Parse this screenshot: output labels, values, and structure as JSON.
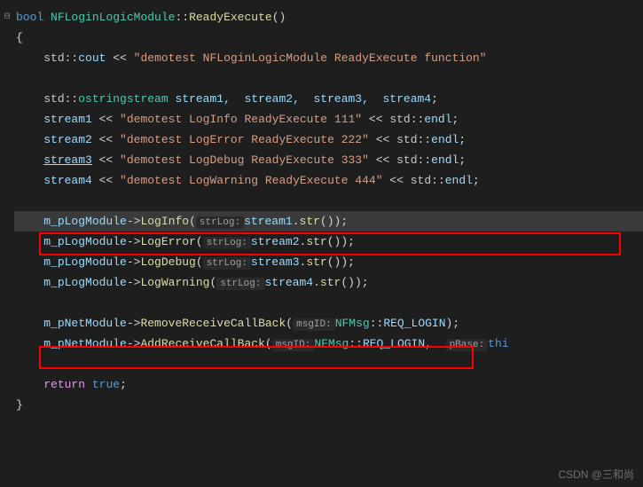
{
  "signature": {
    "ret_type": "bool",
    "class_name": "NFLoginLogicModule",
    "scope": "::",
    "func_name": "ReadyExecute",
    "parens": "()"
  },
  "lines": {
    "brace_open": "{",
    "cout_line": {
      "ns": "std",
      "scope": "::",
      "obj": "cout",
      "op": " << ",
      "str": "\"demotest NFLoginLogicModule ReadyExecute function\""
    },
    "ostringstream_decl": {
      "ns": "std",
      "scope": "::",
      "type": "ostringstream",
      "vars": " stream1,  stream2,  stream3,  stream4",
      "semi": ";"
    },
    "stream1": {
      "var": "stream1",
      "op1": " << ",
      "str": "\"demotest LogInfo ReadyExecute 111\"",
      "op2": " << ",
      "ns": "std",
      "scope": "::",
      "endl": "endl",
      "semi": ";"
    },
    "stream2": {
      "var": "stream2",
      "op1": " << ",
      "str": "\"demotest LogError ReadyExecute 222\"",
      "op2": " << ",
      "ns": "std",
      "scope": "::",
      "endl": "endl",
      "semi": ";"
    },
    "stream3": {
      "var": "stream3",
      "op1": " << ",
      "str": "\"demotest LogDebug ReadyExecute 333\"",
      "op2": " << ",
      "ns": "std",
      "scope": "::",
      "endl": "endl",
      "semi": ";"
    },
    "stream4": {
      "var": "stream4",
      "op1": " << ",
      "str": "\"demotest LogWarning ReadyExecute 444\"",
      "op2": " << ",
      "ns": "std",
      "scope": "::",
      "endl": "endl",
      "semi": ";"
    },
    "log1": {
      "obj": "m_pLogModule",
      "arrow": "->",
      "func": "LogInfo",
      "hint": "strLog:",
      "arg": "stream1",
      "dot": ".",
      "method": "str",
      "parens": "()",
      "end": ");"
    },
    "log2": {
      "obj": "m_pLogModule",
      "arrow": "->",
      "func": "LogError",
      "hint": "strLog:",
      "arg": "stream2",
      "dot": ".",
      "method": "str",
      "parens": "()",
      "end": ");"
    },
    "log3": {
      "obj": "m_pLogModule",
      "arrow": "->",
      "func": "LogDebug",
      "hint": "strLog:",
      "arg": "stream3",
      "dot": ".",
      "method": "str",
      "parens": "()",
      "end": ");"
    },
    "log4": {
      "obj": "m_pLogModule",
      "arrow": "->",
      "func": "LogWarning",
      "hint": "strLog:",
      "arg": "stream4",
      "dot": ".",
      "method": "str",
      "parens": "()",
      "end": ");"
    },
    "net1": {
      "obj": "m_pNetModule",
      "arrow": "->",
      "func": "RemoveReceiveCallBack",
      "hint": "msgID:",
      "ns": "NFMsg",
      "scope": "::",
      "enum": "REQ_LOGIN",
      "end": ");"
    },
    "net2": {
      "obj": "m_pNetModule",
      "arrow": "->",
      "func": "AddReceiveCallBack",
      "hint1": "msgID:",
      "ns": "NFMsg",
      "scope": "::",
      "enum": "REQ_LOGIN",
      "comma": ",  ",
      "hint2": "pBase:",
      "arg2": "thi"
    },
    "return_stmt": {
      "kw": "return",
      "val": "true",
      "semi": ";"
    },
    "brace_close": "}"
  },
  "fold_icon": "⊟",
  "watermark": "CSDN @三和尚"
}
